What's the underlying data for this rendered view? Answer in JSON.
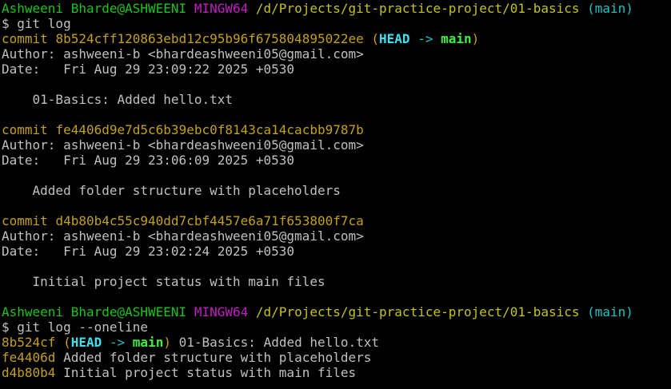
{
  "terminal": {
    "prompt1": {
      "user_host": "Ashweeni Bharde@ASHWEENI",
      "shell": "MINGW64",
      "path": "/d/Projects/git-practice-project/01-basics",
      "branch": "(main)",
      "command": "$ git log"
    },
    "log": [
      {
        "commit_word": "commit",
        "hash": "8b524cff120863ebd12c95b96f675804895022ee",
        "decoration_open": "(",
        "head": "HEAD",
        "arrow": "->",
        "branch": "main",
        "decoration_close": ")",
        "author": "Author: ashweeni-b <bhardeashweeni05@gmail.com>",
        "date": "Date:   Fri Aug 29 23:09:22 2025 +0530",
        "message": "    01-Basics: Added hello.txt"
      },
      {
        "commit_word": "commit",
        "hash": "fe4406d9e7d5c6b39ebc0f8143ca14cacbb9787b",
        "author": "Author: ashweeni-b <bhardeashweeni05@gmail.com>",
        "date": "Date:   Fri Aug 29 23:06:09 2025 +0530",
        "message": "    Added folder structure with placeholders"
      },
      {
        "commit_word": "commit",
        "hash": "d4b80b4c55c940dd7cbf4457e6a71f653800f7ca",
        "author": "Author: ashweeni-b <bhardeashweeni05@gmail.com>",
        "date": "Date:   Fri Aug 29 23:02:24 2025 +0530",
        "message": "    Initial project status with main files"
      }
    ],
    "prompt2": {
      "user_host": "Ashweeni Bharde@ASHWEENI",
      "shell": "MINGW64",
      "path": "/d/Projects/git-practice-project/01-basics",
      "branch": "(main)",
      "command": "$ git log --oneline"
    },
    "oneline": [
      {
        "hash": "8b524cf",
        "decoration_open": "(",
        "head": "HEAD",
        "arrow": "->",
        "branch": "main",
        "decoration_close": ")",
        "message": "01-Basics: Added hello.txt"
      },
      {
        "hash": "fe4406d",
        "message": "Added folder structure with placeholders"
      },
      {
        "hash": "d4b80b4",
        "message": "Initial project status with main files"
      }
    ]
  },
  "colors": {
    "background": "#000000",
    "text": "#c0c0c0",
    "user_host": "#1cc31c",
    "shell": "#c31cc3",
    "path": "#c3c31c",
    "branch_prompt": "#1cc3c3",
    "commit_hash": "#c3a01c",
    "head": "#3ee0f0",
    "branch_main": "#3ef03e"
  }
}
